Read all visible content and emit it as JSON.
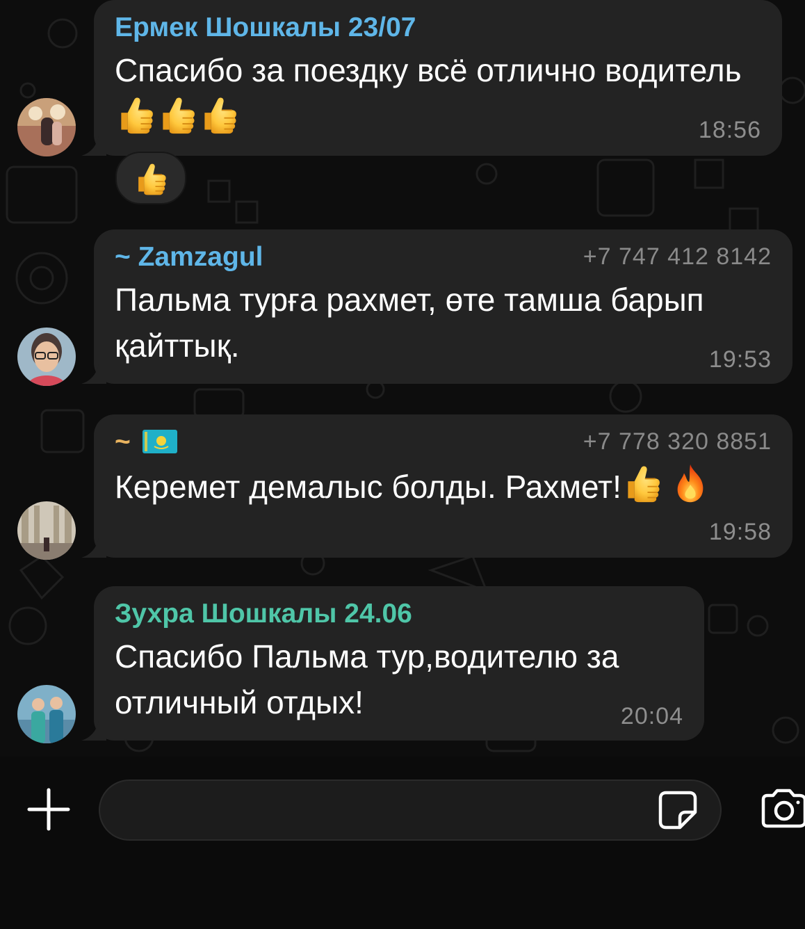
{
  "messages": [
    {
      "sender": "Ермек Шошкалы 23/07",
      "sender_color": "#5fb6e8",
      "text": "Спасибо за поездку всё отлично водитель",
      "emojis": [
        "thumbs-up-emoji",
        "thumbs-up-emoji",
        "thumbs-up-emoji"
      ],
      "time": "18:56",
      "reaction": "thumbs-up-emoji"
    },
    {
      "sender": "~ Zamzagul",
      "sender_color": "#5fb6e8",
      "phone": "+7 747 412 8142",
      "text": "Пальма турға рахмет, өте тамша барып қайттық.",
      "time": "19:53"
    },
    {
      "sender": "~",
      "sender_color": "#e8b35f",
      "sender_flag": "kazakhstan-flag-icon",
      "phone": "+7 778 320 8851",
      "text": "Керемет демалыс болды. Рахмет!",
      "emojis": [
        "thumbs-up-emoji",
        "fire-emoji"
      ],
      "time": "19:58"
    },
    {
      "sender": "Зухра Шошкалы 24.06",
      "sender_color": "#4fc6a8",
      "text": "Спасибо Пальма тур,водителю за отличный отдых!",
      "time": "20:04"
    }
  ],
  "input_bar": {
    "placeholder": "",
    "value": "",
    "icons": [
      "plus-icon",
      "sticker-icon",
      "camera-icon"
    ]
  },
  "colors": {
    "background": "#0d0d0d",
    "bubble": "#232323",
    "time": "#8e8e8e",
    "phone": "#8a8a8a"
  }
}
